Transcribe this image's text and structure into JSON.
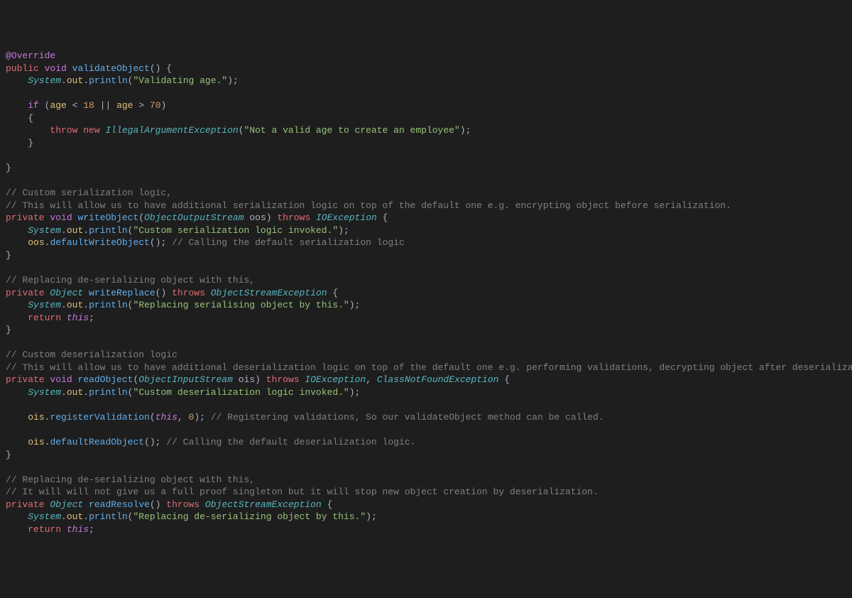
{
  "code": {
    "lines": [
      {
        "raw": "@Override",
        "tokens": [
          [
            "@Override",
            "annotation"
          ]
        ]
      },
      {
        "raw": "public void validateObject() {",
        "tokens": [
          [
            "public",
            "keyword"
          ],
          [
            " ",
            ""
          ],
          [
            "void",
            "keyword2"
          ],
          [
            " ",
            ""
          ],
          [
            "validateObject",
            "method"
          ],
          [
            "()",
            "punc"
          ],
          [
            " {",
            "punc"
          ]
        ]
      },
      {
        "raw": "    System.out.println(\"Validating age.\");",
        "tokens": [
          [
            "    ",
            ""
          ],
          [
            "System",
            "class"
          ],
          [
            ".",
            "punc"
          ],
          [
            "out",
            "field"
          ],
          [
            ".",
            "punc"
          ],
          [
            "println",
            "method"
          ],
          [
            "(",
            "punc"
          ],
          [
            "\"Validating age.\"",
            "string"
          ],
          [
            ");",
            "punc"
          ]
        ]
      },
      {
        "raw": "",
        "tokens": [
          [
            "",
            ""
          ]
        ]
      },
      {
        "raw": "    if (age < 18 || age > 70)",
        "tokens": [
          [
            "    ",
            ""
          ],
          [
            "if",
            "keyword2"
          ],
          [
            " (",
            "punc"
          ],
          [
            "age",
            "field"
          ],
          [
            " < ",
            "punc"
          ],
          [
            "18",
            "num"
          ],
          [
            " || ",
            "punc"
          ],
          [
            "age",
            "field"
          ],
          [
            " > ",
            "punc"
          ],
          [
            "70",
            "num"
          ],
          [
            ")",
            "punc"
          ]
        ]
      },
      {
        "raw": "    {",
        "tokens": [
          [
            "    {",
            "punc"
          ]
        ]
      },
      {
        "raw": "        throw new IllegalArgumentException(\"Not a valid age to create an employee\");",
        "tokens": [
          [
            "        ",
            ""
          ],
          [
            "throw",
            "keyword"
          ],
          [
            " ",
            ""
          ],
          [
            "new",
            "keyword"
          ],
          [
            " ",
            ""
          ],
          [
            "IllegalArgumentException",
            "class"
          ],
          [
            "(",
            "punc"
          ],
          [
            "\"Not a valid age to create an employee\"",
            "string"
          ],
          [
            ");",
            "punc"
          ]
        ]
      },
      {
        "raw": "    }",
        "tokens": [
          [
            "    }",
            "punc"
          ]
        ]
      },
      {
        "raw": "",
        "tokens": [
          [
            "",
            ""
          ]
        ]
      },
      {
        "raw": "}",
        "tokens": [
          [
            "}",
            "punc"
          ]
        ]
      },
      {
        "raw": "",
        "tokens": [
          [
            "",
            ""
          ]
        ]
      },
      {
        "raw": "// Custom serialization logic,",
        "tokens": [
          [
            "// Custom serialization logic,",
            "comment"
          ]
        ]
      },
      {
        "raw": "// This will allow us to have additional serialization logic on top of the default one e.g. encrypting object before serialization.",
        "tokens": [
          [
            "// This will allow us to have additional serialization logic on top of the default one e.g. encrypting object before serialization.",
            "comment"
          ]
        ]
      },
      {
        "raw": "private void writeObject(ObjectOutputStream oos) throws IOException {",
        "tokens": [
          [
            "private",
            "keyword"
          ],
          [
            " ",
            ""
          ],
          [
            "void",
            "keyword2"
          ],
          [
            " ",
            ""
          ],
          [
            "writeObject",
            "method"
          ],
          [
            "(",
            "punc"
          ],
          [
            "ObjectOutputStream",
            "class"
          ],
          [
            " ",
            ""
          ],
          [
            "oos",
            "var"
          ],
          [
            ")",
            "punc"
          ],
          [
            " ",
            ""
          ],
          [
            "throws",
            "keyword"
          ],
          [
            " ",
            ""
          ],
          [
            "IOException",
            "class"
          ],
          [
            " {",
            "punc"
          ]
        ]
      },
      {
        "raw": "    System.out.println(\"Custom serialization logic invoked.\");",
        "tokens": [
          [
            "    ",
            ""
          ],
          [
            "System",
            "class"
          ],
          [
            ".",
            "punc"
          ],
          [
            "out",
            "field"
          ],
          [
            ".",
            "punc"
          ],
          [
            "println",
            "method"
          ],
          [
            "(",
            "punc"
          ],
          [
            "\"Custom serialization logic invoked.\"",
            "string"
          ],
          [
            ");",
            "punc"
          ]
        ]
      },
      {
        "raw": "    oos.defaultWriteObject(); // Calling the default serialization logic",
        "tokens": [
          [
            "    ",
            ""
          ],
          [
            "oos",
            "field"
          ],
          [
            ".",
            "punc"
          ],
          [
            "defaultWriteObject",
            "method"
          ],
          [
            "();",
            "punc"
          ],
          [
            " ",
            ""
          ],
          [
            "// Calling the default serialization logic",
            "comment"
          ]
        ]
      },
      {
        "raw": "}",
        "tokens": [
          [
            "}",
            "punc"
          ]
        ]
      },
      {
        "raw": "",
        "tokens": [
          [
            "",
            ""
          ]
        ]
      },
      {
        "raw": "// Replacing de-serializing object with this,",
        "tokens": [
          [
            "// Replacing de-serializing object with this,",
            "comment"
          ]
        ]
      },
      {
        "raw": "private Object writeReplace() throws ObjectStreamException {",
        "tokens": [
          [
            "private",
            "keyword"
          ],
          [
            " ",
            ""
          ],
          [
            "Object",
            "class"
          ],
          [
            " ",
            ""
          ],
          [
            "writeReplace",
            "method"
          ],
          [
            "()",
            "punc"
          ],
          [
            " ",
            ""
          ],
          [
            "throws",
            "keyword"
          ],
          [
            " ",
            ""
          ],
          [
            "ObjectStreamException",
            "class"
          ],
          [
            " {",
            "punc"
          ]
        ]
      },
      {
        "raw": "    System.out.println(\"Replacing serialising object by this.\");",
        "tokens": [
          [
            "    ",
            ""
          ],
          [
            "System",
            "class"
          ],
          [
            ".",
            "punc"
          ],
          [
            "out",
            "field"
          ],
          [
            ".",
            "punc"
          ],
          [
            "println",
            "method"
          ],
          [
            "(",
            "punc"
          ],
          [
            "\"Replacing serialising object by this.\"",
            "string"
          ],
          [
            ");",
            "punc"
          ]
        ]
      },
      {
        "raw": "    return this;",
        "tokens": [
          [
            "    ",
            ""
          ],
          [
            "return",
            "keyword"
          ],
          [
            " ",
            ""
          ],
          [
            "this",
            "this"
          ],
          [
            ";",
            "punc"
          ]
        ]
      },
      {
        "raw": "}",
        "tokens": [
          [
            "}",
            "punc"
          ]
        ]
      },
      {
        "raw": "",
        "tokens": [
          [
            "",
            ""
          ]
        ]
      },
      {
        "raw": "// Custom deserialization logic",
        "tokens": [
          [
            "// Custom deserialization logic",
            "comment"
          ]
        ]
      },
      {
        "raw": "// This will allow us to have additional deserialization logic on top of the default one e.g. performing validations, decrypting object after deserialization.",
        "tokens": [
          [
            "// This will allow us to have additional deserialization logic on top of the default one e.g. performing validations, decrypting object after deserialization.",
            "comment"
          ]
        ]
      },
      {
        "raw": "private void readObject(ObjectInputStream ois) throws IOException, ClassNotFoundException {",
        "tokens": [
          [
            "private",
            "keyword"
          ],
          [
            " ",
            ""
          ],
          [
            "void",
            "keyword2"
          ],
          [
            " ",
            ""
          ],
          [
            "readObject",
            "method"
          ],
          [
            "(",
            "punc"
          ],
          [
            "ObjectInputStream",
            "class"
          ],
          [
            " ",
            ""
          ],
          [
            "ois",
            "var"
          ],
          [
            ")",
            "punc"
          ],
          [
            " ",
            ""
          ],
          [
            "throws",
            "keyword"
          ],
          [
            " ",
            ""
          ],
          [
            "IOException",
            "class"
          ],
          [
            ", ",
            "punc"
          ],
          [
            "ClassNotFoundException",
            "class"
          ],
          [
            " {",
            "punc"
          ]
        ]
      },
      {
        "raw": "    System.out.println(\"Custom deserialization logic invoked.\");",
        "tokens": [
          [
            "    ",
            ""
          ],
          [
            "System",
            "class"
          ],
          [
            ".",
            "punc"
          ],
          [
            "out",
            "field"
          ],
          [
            ".",
            "punc"
          ],
          [
            "println",
            "method"
          ],
          [
            "(",
            "punc"
          ],
          [
            "\"Custom deserialization logic invoked.\"",
            "string"
          ],
          [
            ");",
            "punc"
          ]
        ]
      },
      {
        "raw": "",
        "tokens": [
          [
            "",
            ""
          ]
        ]
      },
      {
        "raw": "    ois.registerValidation(this, 0); // Registering validations, So our validateObject method can be called.",
        "tokens": [
          [
            "    ",
            ""
          ],
          [
            "ois",
            "field"
          ],
          [
            ".",
            "punc"
          ],
          [
            "registerValidation",
            "method"
          ],
          [
            "(",
            "punc"
          ],
          [
            "this",
            "this"
          ],
          [
            ", ",
            "punc"
          ],
          [
            "0",
            "num"
          ],
          [
            ");",
            "punc"
          ],
          [
            " ",
            ""
          ],
          [
            "// Registering validations, So our validateObject method can be called.",
            "comment"
          ]
        ]
      },
      {
        "raw": "",
        "tokens": [
          [
            "",
            ""
          ]
        ]
      },
      {
        "raw": "    ois.defaultReadObject(); // Calling the default deserialization logic.",
        "tokens": [
          [
            "    ",
            ""
          ],
          [
            "ois",
            "field"
          ],
          [
            ".",
            "punc"
          ],
          [
            "defaultReadObject",
            "method"
          ],
          [
            "();",
            "punc"
          ],
          [
            " ",
            ""
          ],
          [
            "// Calling the default deserialization logic.",
            "comment"
          ]
        ]
      },
      {
        "raw": "}",
        "tokens": [
          [
            "}",
            "punc"
          ]
        ]
      },
      {
        "raw": "",
        "tokens": [
          [
            "",
            ""
          ]
        ]
      },
      {
        "raw": "// Replacing de-serializing object with this,",
        "tokens": [
          [
            "// Replacing de-serializing object with this,",
            "comment"
          ]
        ]
      },
      {
        "raw": "// It will will not give us a full proof singleton but it will stop new object creation by deserialization.",
        "tokens": [
          [
            "// It will will not give us a full proof singleton but it will stop new object creation by deserialization.",
            "comment"
          ]
        ]
      },
      {
        "raw": "private Object readResolve() throws ObjectStreamException {",
        "tokens": [
          [
            "private",
            "keyword"
          ],
          [
            " ",
            ""
          ],
          [
            "Object",
            "class"
          ],
          [
            " ",
            ""
          ],
          [
            "readResolve",
            "method"
          ],
          [
            "()",
            "punc"
          ],
          [
            " ",
            ""
          ],
          [
            "throws",
            "keyword"
          ],
          [
            " ",
            ""
          ],
          [
            "ObjectStreamException",
            "class"
          ],
          [
            " {",
            "punc"
          ]
        ]
      },
      {
        "raw": "    System.out.println(\"Replacing de-serializing object by this.\");",
        "tokens": [
          [
            "    ",
            ""
          ],
          [
            "System",
            "class"
          ],
          [
            ".",
            "punc"
          ],
          [
            "out",
            "field"
          ],
          [
            ".",
            "punc"
          ],
          [
            "println",
            "method"
          ],
          [
            "(",
            "punc"
          ],
          [
            "\"Replacing de-serializing object by this.\"",
            "string"
          ],
          [
            ");",
            "punc"
          ]
        ]
      },
      {
        "raw": "    return this;",
        "tokens": [
          [
            "    ",
            ""
          ],
          [
            "return",
            "keyword"
          ],
          [
            " ",
            ""
          ],
          [
            "this",
            "this"
          ],
          [
            ";",
            "punc"
          ]
        ]
      }
    ]
  }
}
